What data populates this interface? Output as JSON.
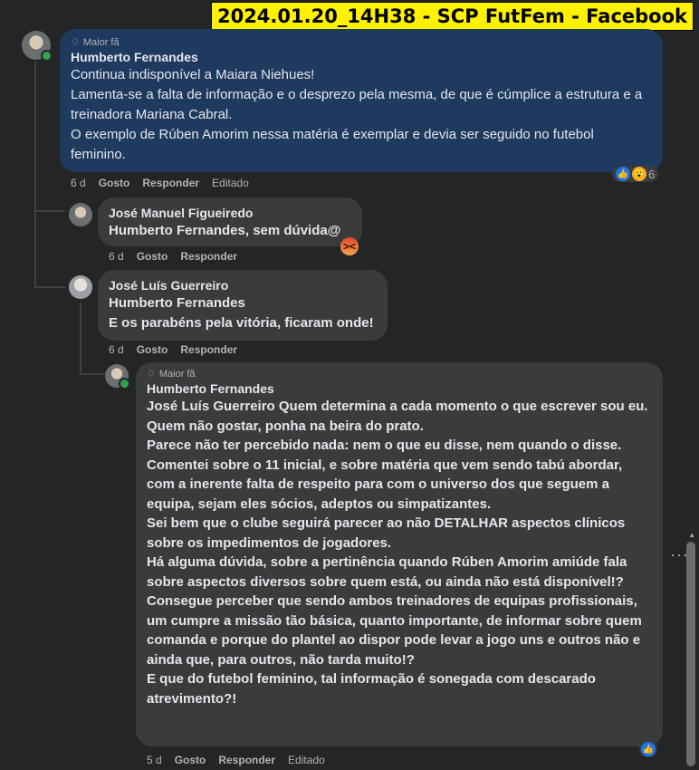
{
  "caption": "2024.01.20_14H38 - SCP FutFem - Facebook",
  "comments": [
    {
      "badge": "Maior fã",
      "author": "Humberto Fernandes",
      "lines": [
        "Continua indisponível a Maiara Niehues!",
        "Lamenta-se a falta de informação e o desprezo pela mesma, de que é cúmplice a estrutura e a treinadora Mariana Cabral.",
        "O exemplo de Rúben Amorim nessa matéria é exemplar e devia ser seguido no futebol feminino."
      ],
      "time": "6 d",
      "like": "Gosto",
      "reply": "Responder",
      "edited": "Editado",
      "reaction_count": "6"
    },
    {
      "author": "José Manuel Figueiredo",
      "text": "Humberto Fernandes, sem dúvida@",
      "time": "6 d",
      "like": "Gosto",
      "reply": "Responder"
    },
    {
      "author": "José Luís Guerreiro",
      "text1": "Humberto Fernandes",
      "text2": "E os parabéns pela vitória, ficaram onde!",
      "time": "6 d",
      "like": "Gosto",
      "reply": "Responder"
    },
    {
      "badge": "Maior fã",
      "author": "Humberto Fernandes",
      "mention": "José Luís Guerreiro",
      "body": " Quem determina a cada momento o que escrever sou eu.\nQuem não gostar, ponha na beira do prato.\nParece não ter percebido nada: nem o que eu disse, nem quando o disse.\nComentei sobre o 11 inicial, e sobre matéria que vem sendo tabú abordar, com a inerente falta de respeito para com o universo dos que seguem a equipa, sejam eles sócios, adeptos ou simpatizantes.\nSei bem que o clube seguirá parecer ao não DETALHAR aspectos clínicos sobre os impedimentos de jogadores.\nHá alguma dúvida, sobre a pertinência quando Rúben Amorim amiúde fala sobre aspectos diversos sobre quem está, ou ainda não está disponível!?\nConsegue perceber que sendo ambos treinadores de equipas profissionais, um cumpre a missão tão básica, quanto importante, de informar sobre quem comanda e porque do plantel ao dispor pode levar a jogo uns e outros não e ainda que, para outros, não tarda muito!?\nE que do futebol feminino, tal informação é sonegada com descarado atrevimento?!",
      "time": "5 d",
      "like": "Gosto",
      "reply": "Responder",
      "edited": "Editado"
    }
  ]
}
